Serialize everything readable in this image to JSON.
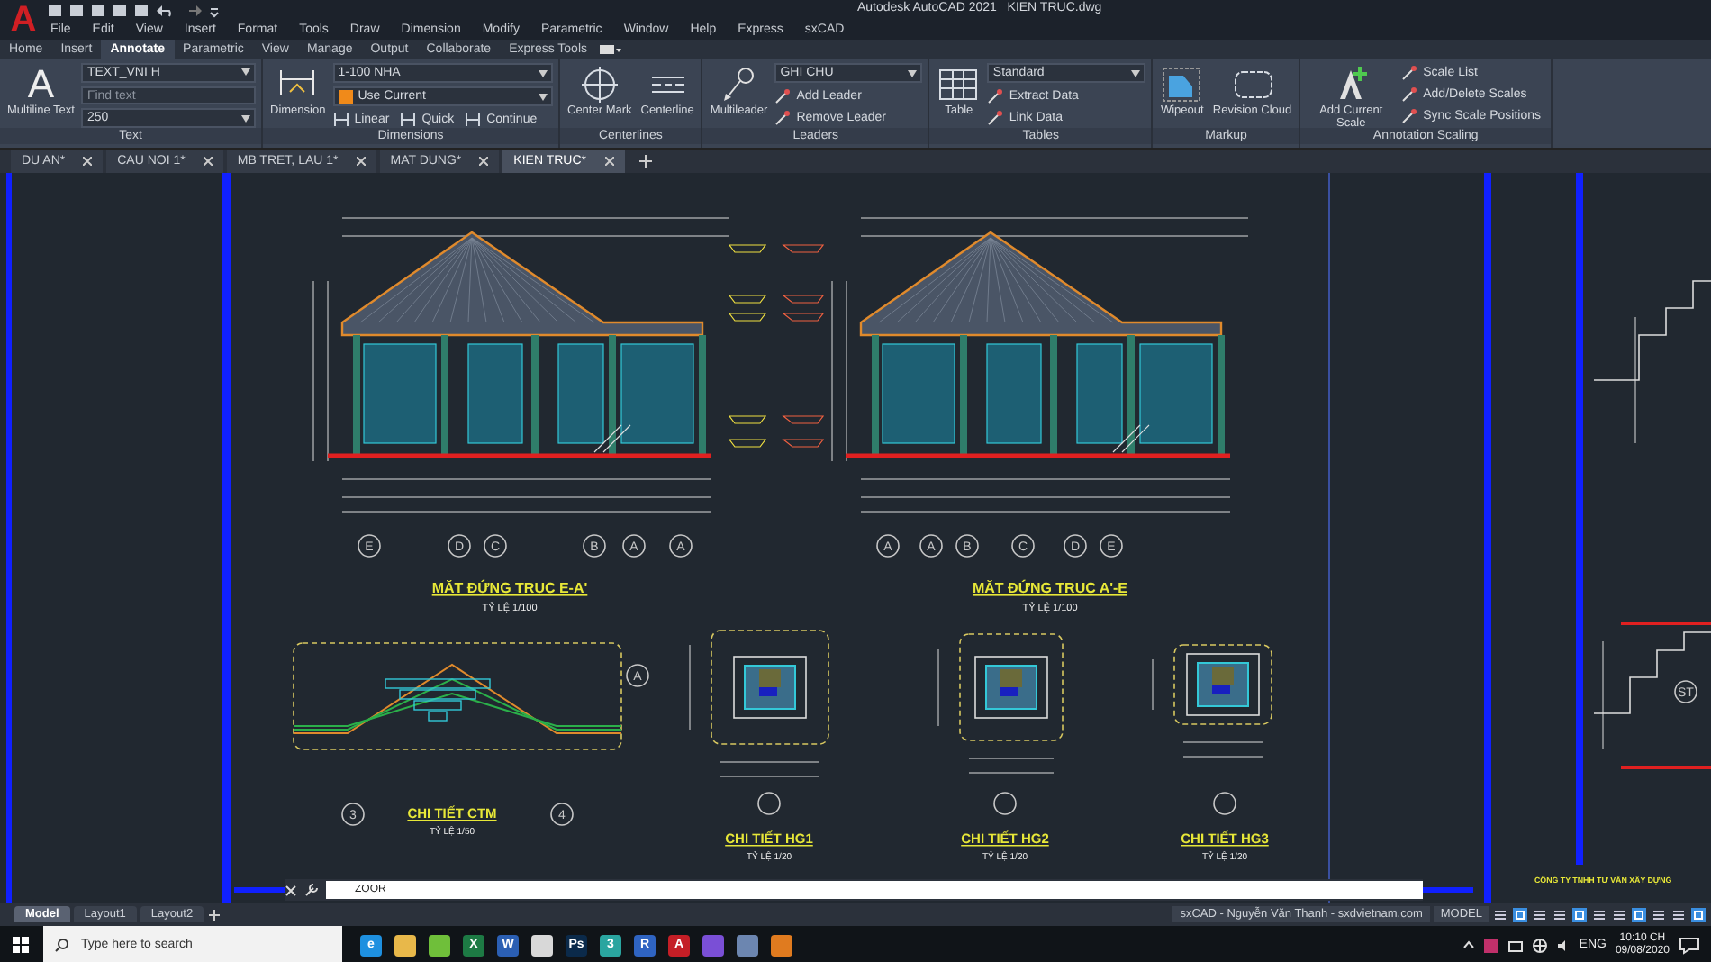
{
  "window": {
    "logo": "A",
    "title": "Autodesk AutoCAD 2021",
    "file": "KIEN TRUC.dwg"
  },
  "menu": [
    "File",
    "Edit",
    "View",
    "Insert",
    "Format",
    "Tools",
    "Draw",
    "Dimension",
    "Modify",
    "Parametric",
    "Window",
    "Help",
    "Express",
    "sxCAD"
  ],
  "ribbon_tabs": [
    {
      "label": "Home",
      "selected": false
    },
    {
      "label": "Insert",
      "selected": false
    },
    {
      "label": "Annotate",
      "selected": true
    },
    {
      "label": "Parametric",
      "selected": false
    },
    {
      "label": "View",
      "selected": false
    },
    {
      "label": "Manage",
      "selected": false
    },
    {
      "label": "Output",
      "selected": false
    },
    {
      "label": "Collaborate",
      "selected": false
    },
    {
      "label": "Express Tools",
      "selected": false
    }
  ],
  "ribbon_panels": [
    {
      "title": "Text",
      "large": [
        {
          "kind": "text",
          "label": "Multiline Text",
          "glyph": "A"
        }
      ],
      "rows": [
        {
          "kind": "dropdown",
          "value": "TEXT_VNI H"
        },
        {
          "kind": "field",
          "placeholder": "Find text"
        },
        {
          "kind": "dropdown",
          "value": "250"
        }
      ]
    },
    {
      "title": "Dimensions",
      "large": [
        {
          "kind": "dimension",
          "label": "Dimension"
        }
      ],
      "rows": [
        {
          "kind": "dropdown",
          "value": "1-100 NHA"
        },
        {
          "kind": "layer",
          "value": "Use Current"
        },
        {
          "kind": "tools",
          "items": [
            "Linear",
            "Quick",
            "Continue"
          ]
        }
      ]
    },
    {
      "title": "Centerlines",
      "large": [
        {
          "kind": "centermark",
          "label": "Center Mark"
        },
        {
          "kind": "centerline",
          "label": "Centerline"
        }
      ]
    },
    {
      "title": "Leaders",
      "large": [
        {
          "kind": "multileader",
          "label": "Multileader"
        }
      ],
      "rows": [
        {
          "kind": "dropdown",
          "value": "GHI CHU"
        },
        {
          "kind": "tool",
          "label": "Add Leader"
        },
        {
          "kind": "tool",
          "label": "Remove Leader"
        }
      ]
    },
    {
      "title": "Tables",
      "large": [
        {
          "kind": "table",
          "label": "Table"
        }
      ],
      "rows": [
        {
          "kind": "dropdown",
          "value": "Standard"
        },
        {
          "kind": "tool",
          "label": "Extract Data"
        },
        {
          "kind": "tool",
          "label": "Link Data"
        }
      ]
    },
    {
      "title": "Markup",
      "large": [
        {
          "kind": "wipeout",
          "label": "Wipeout"
        },
        {
          "kind": "cloud",
          "label": "Revision Cloud"
        }
      ]
    },
    {
      "title": "Annotation Scaling",
      "large": [
        {
          "kind": "scale",
          "label": "Add Current Scale"
        }
      ],
      "rows": [
        {
          "kind": "tool",
          "label": "Scale List"
        },
        {
          "kind": "tool",
          "label": "Add/Delete Scales"
        },
        {
          "kind": "tool",
          "label": "Sync Scale Positions"
        }
      ]
    }
  ],
  "doc_tabs": [
    {
      "label": "DU AN*",
      "selected": false
    },
    {
      "label": "CAU NOI 1*",
      "selected": false
    },
    {
      "label": "MB TRET, LAU 1*",
      "selected": false
    },
    {
      "label": "MAT DUNG*",
      "selected": false
    },
    {
      "label": "KIEN TRUC*",
      "selected": true
    }
  ],
  "drawing": {
    "elevations": [
      {
        "title": "MẶT ĐỨNG TRỤC E-A'",
        "scale": "TỶ LỆ 1/100",
        "axes": [
          "E",
          "D",
          "C",
          "B",
          "A",
          "A"
        ]
      },
      {
        "title": "MẶT ĐỨNG TRỤC A'-E",
        "scale": "TỶ LỆ 1/100",
        "axes": [
          "A",
          "A",
          "B",
          "C",
          "D",
          "E"
        ]
      }
    ],
    "details": [
      {
        "title": "CHI TIẾT CTM",
        "scale": "TỶ LỆ 1/50",
        "axes": [
          "3",
          "4"
        ]
      },
      {
        "title": "CHI TIẾT HG1",
        "scale": "TỶ LỆ 1/20"
      },
      {
        "title": "CHI TIẾT HG2",
        "scale": "TỶ LỆ 1/20"
      },
      {
        "title": "CHI TIẾT HG3",
        "scale": "TỶ LỆ 1/20"
      }
    ],
    "side_axis": "A",
    "section_axis": "ST",
    "company": "CÔNG TY TNHH TƯ VẤN XÂY DỰNG"
  },
  "command": {
    "value": "ZOOR"
  },
  "layout_tabs": [
    {
      "label": "Model",
      "selected": true
    },
    {
      "label": "Layout1",
      "selected": false
    },
    {
      "label": "Layout2",
      "selected": false
    }
  ],
  "status_bar": {
    "credit": "sxCAD - Nguyễn Văn Thanh - sxdvietnam.com",
    "space": "MODEL"
  },
  "taskbar": {
    "search": {
      "placeholder": "Type here to search"
    },
    "apps": [
      {
        "glyph": "e",
        "color": "#1e90e0"
      },
      {
        "color": "#e8b84a"
      },
      {
        "color": "#6fbf3a"
      },
      {
        "glyph": "X",
        "color": "#1d7a44"
      },
      {
        "glyph": "W",
        "color": "#2b5fb3"
      },
      {
        "color": "#d8d8d8"
      },
      {
        "glyph": "Ps",
        "color": "#0b2a4a"
      },
      {
        "glyph": "3",
        "color": "#2aa5a0"
      },
      {
        "glyph": "R",
        "color": "#2f64c2"
      },
      {
        "glyph": "A",
        "color": "#c41e26"
      },
      {
        "color": "#7a4fd6"
      },
      {
        "color": "#6c86b0"
      },
      {
        "color": "#e07b1f"
      }
    ],
    "language": "ENG",
    "time": "10:10 CH",
    "date": "09/08/2020"
  }
}
